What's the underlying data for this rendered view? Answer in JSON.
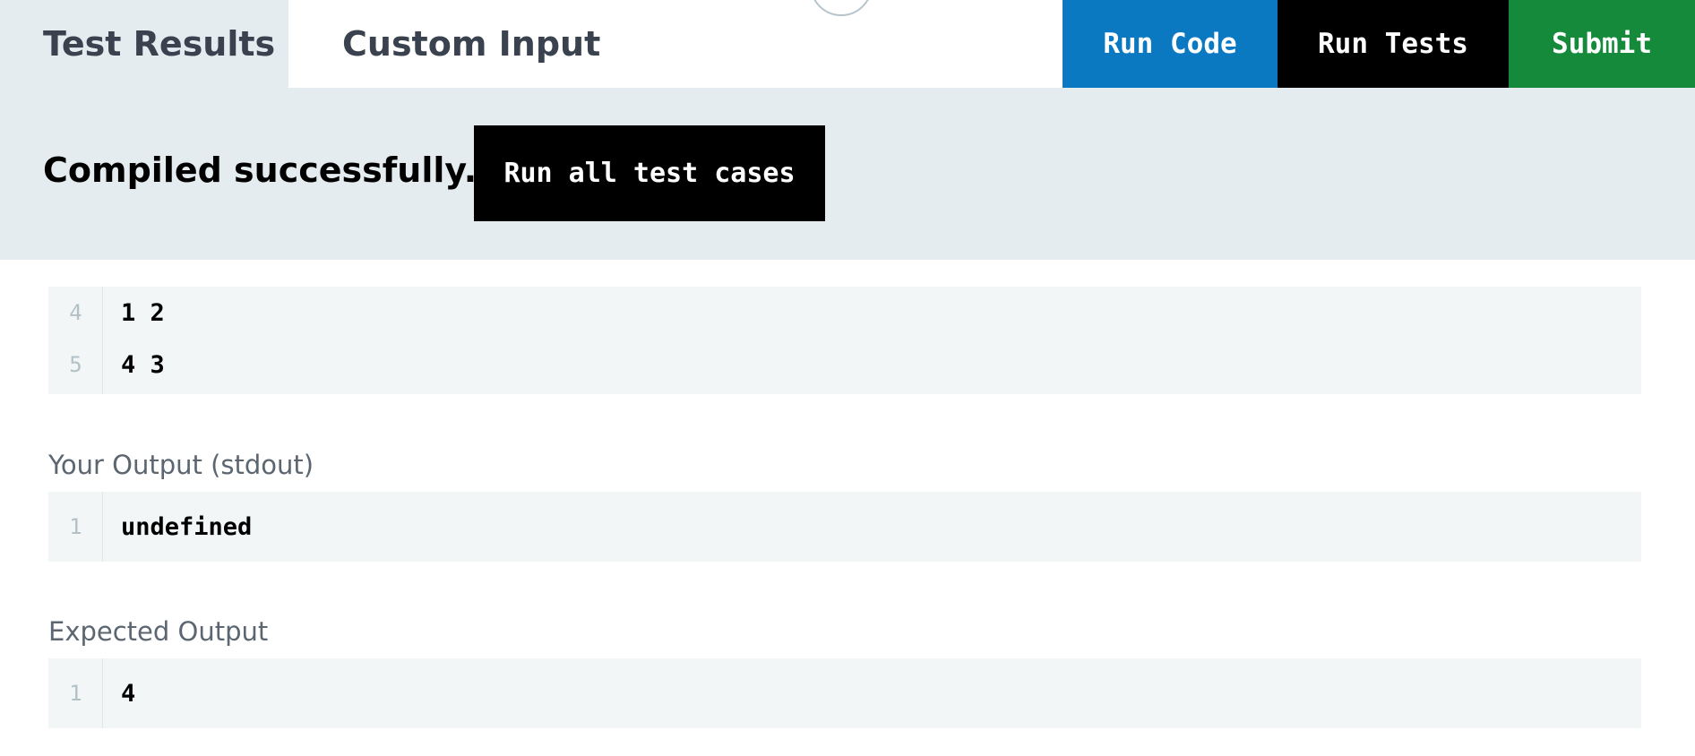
{
  "tabs": {
    "test_results": "Test Results",
    "custom_input": "Custom Input"
  },
  "actions": {
    "run_code": "Run Code",
    "run_tests": "Run Tests",
    "submit": "Submit"
  },
  "status": {
    "message": "Compiled successfully.",
    "run_all_label": "Run all test cases"
  },
  "input_block": {
    "lines": [
      {
        "no": "4",
        "text": "1 2"
      },
      {
        "no": "5",
        "text": "4 3"
      }
    ]
  },
  "stdout": {
    "label": "Your Output (stdout)",
    "lines": [
      {
        "no": "1",
        "text": "undefined"
      }
    ]
  },
  "expected": {
    "label": "Expected Output",
    "lines": [
      {
        "no": "1",
        "text": "4"
      }
    ]
  },
  "colors": {
    "run_code_bg": "#0a79c2",
    "run_tests_bg": "#000000",
    "submit_bg": "#148a3a",
    "panel_bg": "#e5ecef",
    "code_bg": "#f2f6f7"
  }
}
